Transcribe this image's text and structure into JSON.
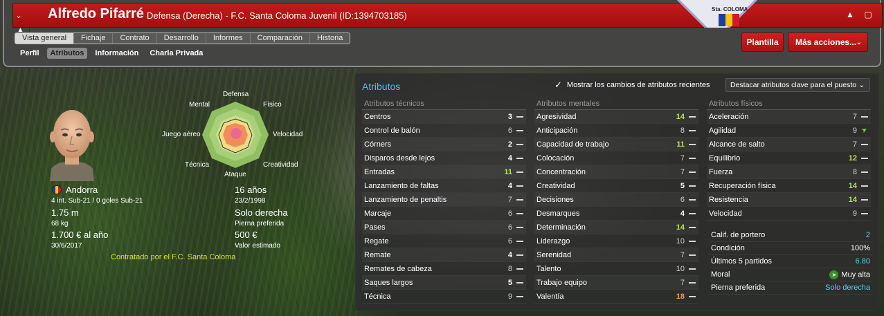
{
  "header": {
    "player_name": "Alfredo Pifarré",
    "subtitle": "Defensa (Derecha) - F.C. Santa Coloma Juvenil (ID:1394703185)",
    "crest_text": "Sta. COLOMA",
    "main_tabs": [
      "Vista general",
      "Fichaje",
      "Contrato",
      "Desarrollo",
      "Informes",
      "Comparación",
      "Historia"
    ],
    "sub_tabs": [
      "Perfil",
      "Atributos",
      "Información",
      "Charla Privada"
    ],
    "plantilla_label": "Plantilla",
    "more_actions_label": "Más acciones..."
  },
  "radar": {
    "labels": {
      "defensa": "Defensa",
      "fisico": "Físico",
      "velocidad": "Velocidad",
      "creatividad": "Creatividad",
      "ataque": "Ataque",
      "tecnica": "Técnica",
      "juego_aereo": "Juego aéreo",
      "mental": "Mental"
    }
  },
  "player_info": {
    "nation": "Andorra",
    "caps": "4 int. Sub-21 / 0 goles Sub-21",
    "height": "1.75 m",
    "weight": "68 kg",
    "wage": "1.700 € al año",
    "contract_end": "30/6/2017",
    "age": "16 años",
    "birth_date": "23/2/1998",
    "foot": "Solo derecha",
    "foot_label": "Pierna preferida",
    "value": "500 €",
    "value_label": "Valor estimado",
    "contract_note": "Contratado por el F.C. Santa Coloma"
  },
  "attributes": {
    "title": "Atributos",
    "show_changes_label": "Mostrar los cambios de atributos recientes",
    "highlight_label": "Destacar atributos clave para el puesto",
    "technical": {
      "header": "Atributos técnicos",
      "items": [
        {
          "name": "Centros",
          "value": "3",
          "color": "white",
          "trend": "dash"
        },
        {
          "name": "Control de balón",
          "value": "6",
          "color": "grey",
          "trend": "dash"
        },
        {
          "name": "Córners",
          "value": "2",
          "color": "white",
          "trend": "dash"
        },
        {
          "name": "Disparos desde lejos",
          "value": "4",
          "color": "white",
          "trend": "dash"
        },
        {
          "name": "Entradas",
          "value": "11",
          "color": "green",
          "trend": "dash"
        },
        {
          "name": "Lanzamiento de faltas",
          "value": "4",
          "color": "white",
          "trend": "dash"
        },
        {
          "name": "Lanzamiento de penaltis",
          "value": "7",
          "color": "grey",
          "trend": "dash"
        },
        {
          "name": "Marcaje",
          "value": "6",
          "color": "grey",
          "trend": "dash"
        },
        {
          "name": "Pases",
          "value": "6",
          "color": "grey",
          "trend": "dash"
        },
        {
          "name": "Regate",
          "value": "6",
          "color": "grey",
          "trend": "dash"
        },
        {
          "name": "Remate",
          "value": "4",
          "color": "white",
          "trend": "dash"
        },
        {
          "name": "Remates de cabeza",
          "value": "8",
          "color": "grey",
          "trend": "dash"
        },
        {
          "name": "Saques largos",
          "value": "5",
          "color": "white",
          "trend": "dash"
        },
        {
          "name": "Técnica",
          "value": "9",
          "color": "grey",
          "trend": "dash"
        }
      ]
    },
    "mental": {
      "header": "Atributos mentales",
      "items": [
        {
          "name": "Agresividad",
          "value": "14",
          "color": "green",
          "trend": "dash"
        },
        {
          "name": "Anticipación",
          "value": "8",
          "color": "grey",
          "trend": "dash"
        },
        {
          "name": "Capacidad de trabajo",
          "value": "11",
          "color": "green",
          "trend": "dash"
        },
        {
          "name": "Colocación",
          "value": "7",
          "color": "grey",
          "trend": "dash"
        },
        {
          "name": "Concentración",
          "value": "7",
          "color": "grey",
          "trend": "dash"
        },
        {
          "name": "Creatividad",
          "value": "5",
          "color": "white",
          "trend": "dash"
        },
        {
          "name": "Decisiones",
          "value": "6",
          "color": "grey",
          "trend": "dash"
        },
        {
          "name": "Desmarques",
          "value": "4",
          "color": "white",
          "trend": "dash"
        },
        {
          "name": "Determinación",
          "value": "14",
          "color": "green",
          "trend": "dash"
        },
        {
          "name": "Liderazgo",
          "value": "10",
          "color": "grey",
          "trend": "dash"
        },
        {
          "name": "Serenidad",
          "value": "7",
          "color": "grey",
          "trend": "dash"
        },
        {
          "name": "Talento",
          "value": "10",
          "color": "grey",
          "trend": "dash"
        },
        {
          "name": "Trabajo equipo",
          "value": "7",
          "color": "grey",
          "trend": "dash"
        },
        {
          "name": "Valentía",
          "value": "18",
          "color": "orange",
          "trend": "dash"
        }
      ]
    },
    "physical": {
      "header": "Atributos físicos",
      "items": [
        {
          "name": "Aceleración",
          "value": "7",
          "color": "grey",
          "trend": "dash"
        },
        {
          "name": "Agilidad",
          "value": "9",
          "color": "grey",
          "trend": "up"
        },
        {
          "name": "Alcance de salto",
          "value": "7",
          "color": "grey",
          "trend": "dash"
        },
        {
          "name": "Equilibrio",
          "value": "12",
          "color": "green",
          "trend": "dash"
        },
        {
          "name": "Fuerza",
          "value": "8",
          "color": "grey",
          "trend": "dash"
        },
        {
          "name": "Recuperación física",
          "value": "14",
          "color": "green",
          "trend": "dash"
        },
        {
          "name": "Resistencia",
          "value": "14",
          "color": "green",
          "trend": "dash"
        },
        {
          "name": "Velocidad",
          "value": "9",
          "color": "grey",
          "trend": "dash"
        }
      ]
    },
    "summary": {
      "gk_rating_label": "Calif. de portero",
      "gk_rating": "2",
      "condition_label": "Condición",
      "condition": "100%",
      "last5_label": "Últimos 5 partidos",
      "last5": "6.80",
      "morale_label": "Moral",
      "morale": "Muy alta",
      "foot_label": "Pierna preferida",
      "foot": "Solo derecha"
    }
  },
  "colors": {
    "accent_red": "#c41a1a",
    "attr_title": "#5bb8e8",
    "green_value": "#b9e44a",
    "orange_value": "#f0a020",
    "contract_note": "#d6e23a"
  }
}
